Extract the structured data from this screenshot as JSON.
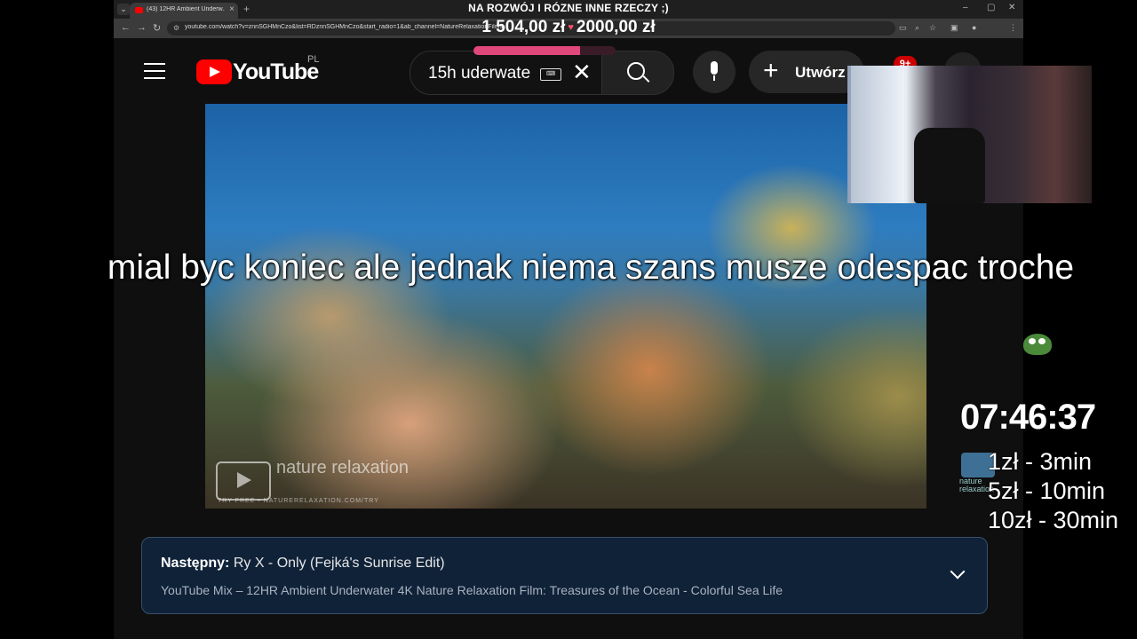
{
  "stream": {
    "goal_title": "NA ROZWÓJ I RÓZNE INNE RZECZY ;)",
    "goal_current": "1 504,00 zł",
    "goal_target": "2000,00 zł",
    "goal_progress_fraction": 0.75,
    "caption": "mial byc koniec ale jednak niema szans musze odespac troche",
    "timer": "07:46:37",
    "prices": [
      "1zł - 3min",
      "5zł - 10min",
      "10zł - 30min"
    ]
  },
  "browser": {
    "tab_title": "(43) 12HR Ambient Underw...",
    "url": "youtube.com/watch?v=znnSGHMnCzo&list=RDznnSGHMnCzo&start_radio=1&ab_channel=NatureRelaxationFilms"
  },
  "youtube": {
    "logo_text": "YouTube",
    "country": "PL",
    "search_value": "15h uderwate",
    "create_label": "Utwórz",
    "notification_count": "9+"
  },
  "video": {
    "watermark": "nature relaxation",
    "watermark_url": "TRY FREE • NATURERELAXATION.COM/TRY"
  },
  "next_card": {
    "label": "Następny:",
    "title": "Ry X - Only (Fejká's Sunrise Edit)",
    "subtitle": "YouTube Mix – 12HR Ambient Underwater 4K Nature Relaxation Film: Treasures of the Ocean - Colorful Sea Life"
  },
  "colors": {
    "youtube_red": "#ff0000",
    "goal_bar": "#e0477a",
    "next_card_bg": "#0f2238"
  }
}
